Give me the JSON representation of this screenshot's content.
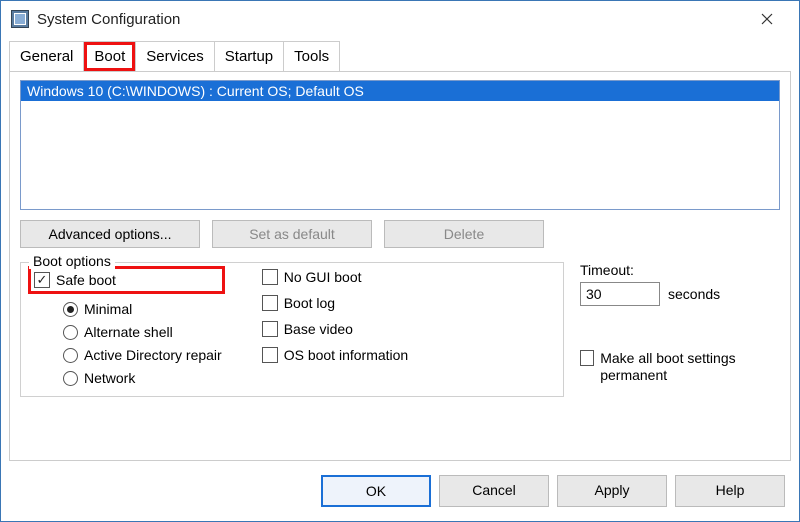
{
  "window": {
    "title": "System Configuration"
  },
  "tabs": {
    "general": "General",
    "boot": "Boot",
    "services": "Services",
    "startup": "Startup",
    "tools": "Tools",
    "active": "boot"
  },
  "boot_list": {
    "items": [
      "Windows 10 (C:\\WINDOWS) : Current OS; Default OS"
    ]
  },
  "buttons": {
    "advanced": "Advanced options...",
    "set_default": "Set as default",
    "delete": "Delete"
  },
  "boot_options": {
    "legend": "Boot options",
    "safe_boot": {
      "label": "Safe boot",
      "checked": true
    },
    "radios": {
      "minimal": "Minimal",
      "alt_shell": "Alternate shell",
      "ad_repair": "Active Directory repair",
      "network": "Network",
      "selected": "minimal"
    },
    "no_gui": {
      "label": "No GUI boot",
      "checked": false
    },
    "boot_log": {
      "label": "Boot log",
      "checked": false
    },
    "base_video": {
      "label": "Base video",
      "checked": false
    },
    "os_info": {
      "label": "OS boot information",
      "checked": false
    }
  },
  "timeout": {
    "label": "Timeout:",
    "value": "30",
    "unit": "seconds"
  },
  "permanent": {
    "label": "Make all boot settings permanent",
    "checked": false
  },
  "footer": {
    "ok": "OK",
    "cancel": "Cancel",
    "apply": "Apply",
    "help": "Help"
  }
}
